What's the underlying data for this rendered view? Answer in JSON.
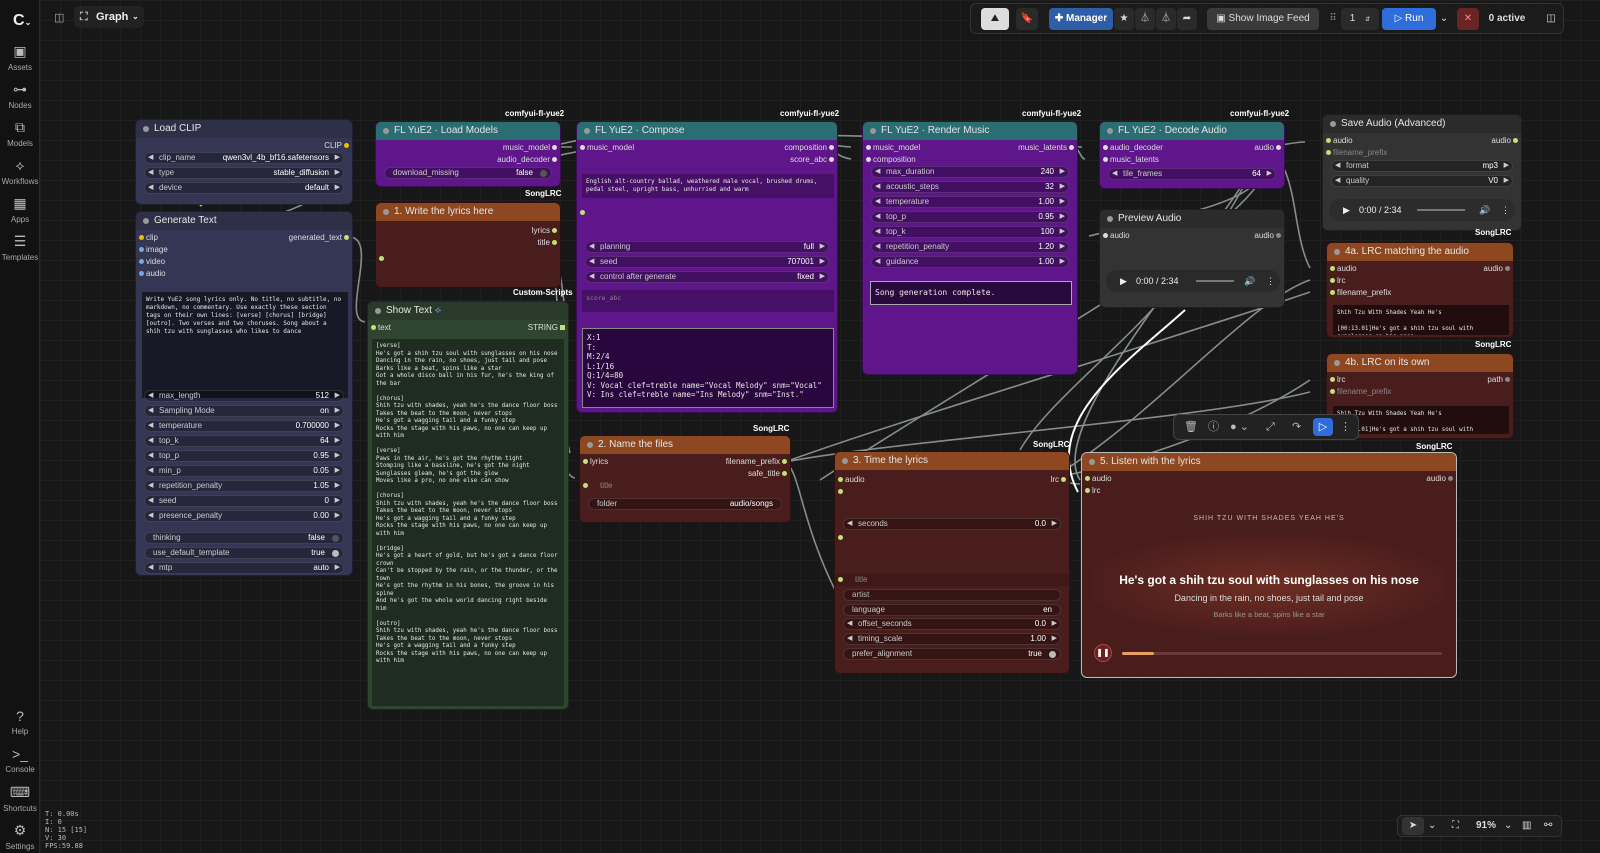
{
  "header": {
    "graph_label": "Graph"
  },
  "sidebar": {
    "items": [
      {
        "label": "Assets",
        "icon": "assets-icon",
        "glyph": "▣"
      },
      {
        "label": "Nodes",
        "icon": "nodes-icon",
        "glyph": "⊶"
      },
      {
        "label": "Models",
        "icon": "models-icon",
        "glyph": "⧉"
      },
      {
        "label": "Workflows",
        "icon": "workflows-icon",
        "glyph": "⟡"
      },
      {
        "label": "Apps",
        "icon": "apps-icon",
        "glyph": "▦"
      },
      {
        "label": "Templates",
        "icon": "templates-icon",
        "glyph": "☰"
      }
    ],
    "bottom": [
      {
        "label": "Help",
        "icon": "help-icon",
        "glyph": "?"
      },
      {
        "label": "Console",
        "icon": "console-icon",
        "glyph": ">_"
      },
      {
        "label": "Shortcuts",
        "icon": "shortcuts-icon",
        "glyph": "⌨"
      },
      {
        "label": "Settings",
        "icon": "settings-icon",
        "glyph": "⚙"
      }
    ]
  },
  "stats": {
    "t": "T: 0.00s",
    "i": "I: 0",
    "n": "N: 15 [15]",
    "v": "V: 30",
    "fps": "FPS:59.88"
  },
  "topbar": {
    "manager": "Manager",
    "show_image_feed": "Show Image Feed",
    "queue_count": "1",
    "run": "Run",
    "active": "0 active"
  },
  "badges": {
    "yue2": "comfyui-fl-yue2",
    "songlrc": "SongLRC",
    "custom": "Custom-Scripts"
  },
  "load_clip": {
    "title": "Load CLIP",
    "out": "CLIP",
    "clip_name_l": "clip_name",
    "clip_name": "qwen3vl_4b_bf16.safetensors",
    "type_l": "type",
    "type": "stable_diffusion",
    "device_l": "device",
    "device": "default"
  },
  "gen_text": {
    "title": "Generate Text",
    "in_clip": "clip",
    "in_image": "image",
    "in_video": "video",
    "in_audio": "audio",
    "out": "generated_text",
    "prompt": "Write YuE2 song lyrics only. No title, no subtitle, no markdown, no commentary. Use exactly these section tags on their own lines: [verse] [chorus] [bridge] [outro]. Two verses and two choruses. Song about a shih tzu with sunglasses who likes to dance",
    "widgets": [
      {
        "l": "max_length",
        "v": "512"
      },
      {
        "l": "Sampling Mode",
        "v": "on"
      },
      {
        "l": "temperature",
        "v": "0.700000"
      },
      {
        "l": "top_k",
        "v": "64"
      },
      {
        "l": "top_p",
        "v": "0.95"
      },
      {
        "l": "min_p",
        "v": "0.05"
      },
      {
        "l": "repetition_penalty",
        "v": "1.05"
      },
      {
        "l": "seed",
        "v": "0"
      },
      {
        "l": "presence_penalty",
        "v": "0.00"
      }
    ],
    "thinking_l": "thinking",
    "thinking": "false",
    "udt_l": "use_default_template",
    "udt": "true",
    "mtp_l": "mtp",
    "mtp": "auto"
  },
  "load_models": {
    "title": "FL YuE2 · Load Models",
    "out1": "music_model",
    "out2": "audio_decoder",
    "dl_l": "download_missing",
    "dl": "false"
  },
  "write_lyrics": {
    "title": "1. Write the lyrics here",
    "out1": "lyrics",
    "out2": "title"
  },
  "show_text": {
    "title": "Show Text",
    "in": "text",
    "out": "STRING",
    "text": "[verse]\nHe's got a shih tzu soul with sunglasses on his nose\nDancing in the rain, no shoes, just tail and pose\nBarks like a beat, spins like a star\nGot a whole disco ball in his fur, he's the king of the bar\n\n[chorus]\nShih tzu with shades, yeah he's the dance floor boss\nTakes the beat to the moon, never stops\nHe's got a wagging tail and a funky step\nRocks the stage with his paws, no one can keep up with him\n\n[verse]\nPaws in the air, he's got the rhythm tight\nStomping like a bassline, he's got the night\nSunglasses gleam, he's got the glow\nMoves like a pro, no one else can show\n\n[chorus]\nShih tzu with shades, yeah he's the dance floor boss\nTakes the beat to the moon, never stops\nHe's got a wagging tail and a funky step\nRocks the stage with his paws, no one can keep up with him\n\n[bridge]\nHe's got a heart of gold, but he's got a dance floor crown\nCan't be stopped by the rain, or the thunder, or the town\nHe's got the rhythm in his bones, the groove in his spine\nAnd he's got the whole world dancing right beside him\n\n[outro]\nShih tzu with shades, yeah he's the dance floor boss\nTakes the beat to the moon, never stops\nHe's got a wagging tail and a funky step\nRocks the stage with his paws, no one can keep up with him"
  },
  "compose": {
    "title": "FL YuE2 · Compose",
    "in": "music_model",
    "out1": "composition",
    "out2": "score_abc",
    "tags": "English alt-country ballad, weathered male vocal, brushed drums, pedal steel, upright bass, unhurried and warm",
    "planning_l": "planning",
    "planning": "full",
    "seed_l": "seed",
    "seed": "707001",
    "cag_l": "control after generate",
    "cag": "fixed",
    "score_ph": "score_abc",
    "abc": "X:1\nT:\nM:2/4\nL:1/16\nQ:1/4=80\nV: Vocal clef=treble name=\"Vocal Melody\" snm=\"Vocal\"\nV: Ins clef=treble name=\"Ins Melody\" snm=\"Inst.\""
  },
  "render": {
    "title": "FL YuE2 · Render Music",
    "in1": "music_model",
    "in2": "composition",
    "out": "music_latents",
    "widgets": [
      {
        "l": "max_duration",
        "v": "240"
      },
      {
        "l": "acoustic_steps",
        "v": "32"
      },
      {
        "l": "temperature",
        "v": "1.00"
      },
      {
        "l": "top_p",
        "v": "0.95"
      },
      {
        "l": "top_k",
        "v": "100"
      },
      {
        "l": "repetition_penalty",
        "v": "1.20"
      },
      {
        "l": "guidance",
        "v": "1.00"
      }
    ],
    "status": "Song generation complete."
  },
  "decode": {
    "title": "FL YuE2 · Decode Audio",
    "in1": "audio_decoder",
    "in2": "music_latents",
    "out": "audio",
    "tf_l": "tile_frames",
    "tf": "64"
  },
  "preview": {
    "title": "Preview Audio",
    "in": "audio",
    "out": "audio",
    "time": "0:00 / 2:34"
  },
  "save_audio": {
    "title": "Save Audio (Advanced)",
    "in": "audio",
    "out": "audio",
    "fp": "filename_prefix",
    "format_l": "format",
    "format": "mp3",
    "quality_l": "quality",
    "quality": "V0",
    "time": "0:00 / 2:34"
  },
  "lrc_a": {
    "title": "4a. LRC matching the audio",
    "in1": "audio",
    "in2": "lrc",
    "in3": "filename_prefix",
    "out": "audio",
    "text": "Shih Tzu With Shades Yeah He's\n\n[00:13.01]He's got a shih tzu soul with sunglasses on his nose"
  },
  "lrc_b": {
    "title": "4b. LRC on its own",
    "in1": "lrc",
    "in2": "filename_prefix",
    "out": "path",
    "text": "Shih Tzu With Shades Yeah He's\n\n[00:13.01]He's got a shih tzu soul with sunglasses on his nose"
  },
  "name_files": {
    "title": "2. Name the files",
    "in": "lyrics",
    "out1": "filename_prefix",
    "out2": "safe_title",
    "title_ph": "title",
    "folder_l": "folder",
    "folder": "audio/songs"
  },
  "time_lyrics": {
    "title": "3. Time the lyrics",
    "in": "audio",
    "out": "lrc",
    "seconds_l": "seconds",
    "seconds": "0.0",
    "title_ph": "title",
    "artist_ph": "artist",
    "lang_l": "language",
    "lang": "en",
    "offset_l": "offset_seconds",
    "offset": "0.0",
    "ts_l": "timing_scale",
    "ts": "1.00",
    "pa_l": "prefer_alignment",
    "pa": "true"
  },
  "listen": {
    "title": "5. Listen with the lyrics",
    "in1": "audio",
    "in2": "lrc",
    "out": "audio",
    "song_title": "SHIH TZU WITH SHADES YEAH HE'S",
    "current": "He's got a shih tzu soul with sunglasses on his nose",
    "next": "Dancing in the rain, no shoes, just tail and pose",
    "next2": "Barks like a beat, spins like a star",
    "progress": 0.1
  },
  "zoom": "91%",
  "colors": {
    "purple": "#5e168a",
    "teal": "#2a6d73",
    "brown": "#8e4821",
    "darkred": "#4a1d1d",
    "darkgreen": "#2f4530",
    "navy": "#353554",
    "accent": "#2f6ddb"
  }
}
